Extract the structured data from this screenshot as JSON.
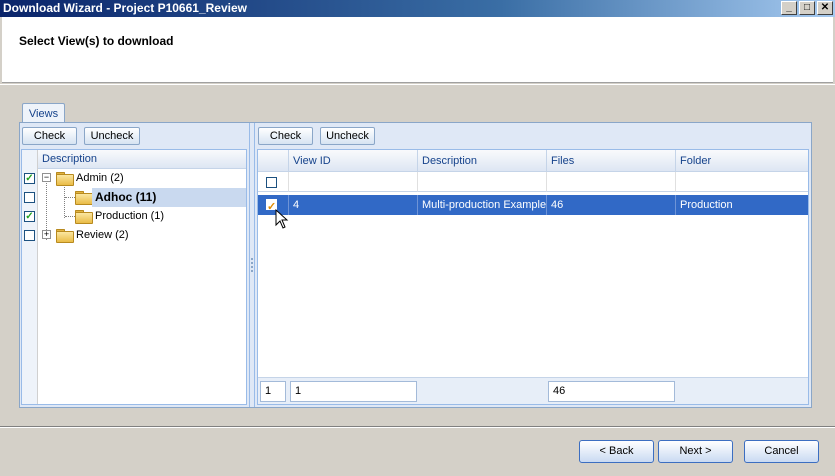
{
  "window": {
    "title": "Download Wizard - Project P10661_Review",
    "minimize": "_",
    "maximize": "□",
    "close": "✕"
  },
  "header": {
    "title": "Select View(s) to download"
  },
  "tabs": [
    {
      "label": "Views",
      "active": true
    }
  ],
  "left_pane": {
    "check_label": "Check",
    "uncheck_label": "Uncheck",
    "column_header": "Description",
    "tree": [
      {
        "label": "Admin (2)",
        "checked": true,
        "expanded": true,
        "level": 0
      },
      {
        "label": "Adhoc (11)",
        "checked": false,
        "selected": true,
        "level": 1
      },
      {
        "label": "Production (1)",
        "checked": true,
        "level": 1
      },
      {
        "label": "Review (2)",
        "checked": false,
        "expanded": false,
        "level": 0
      }
    ]
  },
  "right_pane": {
    "check_label": "Check",
    "uncheck_label": "Uncheck",
    "columns": [
      "View ID",
      "Description",
      "Files",
      "Folder"
    ],
    "rows": [
      {
        "checked": true,
        "view_id": "4",
        "description": "Multi-production Example",
        "files": "46",
        "folder": "Production"
      }
    ],
    "footer": {
      "row_count": "1",
      "view_id_total": "1",
      "files_total": "46"
    }
  },
  "buttons": {
    "back": "< Back",
    "next": "Next >",
    "cancel": "Cancel"
  },
  "colors": {
    "selection": "#3169c6",
    "header_text": "#15428b",
    "panel_bg": "#dfe8f6"
  }
}
